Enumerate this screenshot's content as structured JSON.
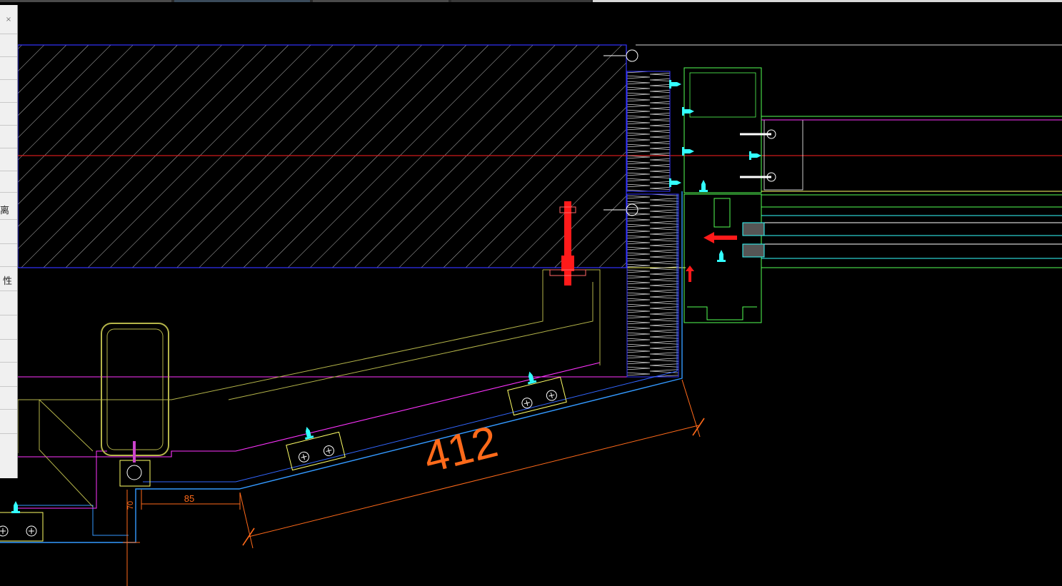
{
  "properties_panel": {
    "close_glyph": "×",
    "labels": [
      "离",
      "性"
    ]
  },
  "drawing": {
    "dimensions": [
      {
        "name": "diagonal-length",
        "text": "412"
      },
      {
        "name": "horizontal-offset",
        "text": "85"
      },
      {
        "name": "vertical-offset",
        "text": "70"
      }
    ],
    "colors": {
      "background": "#000000",
      "wall": "#3333ff",
      "hatch": "#bbbbbb",
      "centerline": "#ff2020",
      "mullion": "#55ff55",
      "bracket": "#ffff66",
      "magenta": "#ff33ff",
      "olive": "#b5b54a",
      "cyan": "#33ffff",
      "dimension": "#ff6a1a",
      "anchor": "#ff1a1a",
      "guide": "#d8d8d8"
    }
  }
}
